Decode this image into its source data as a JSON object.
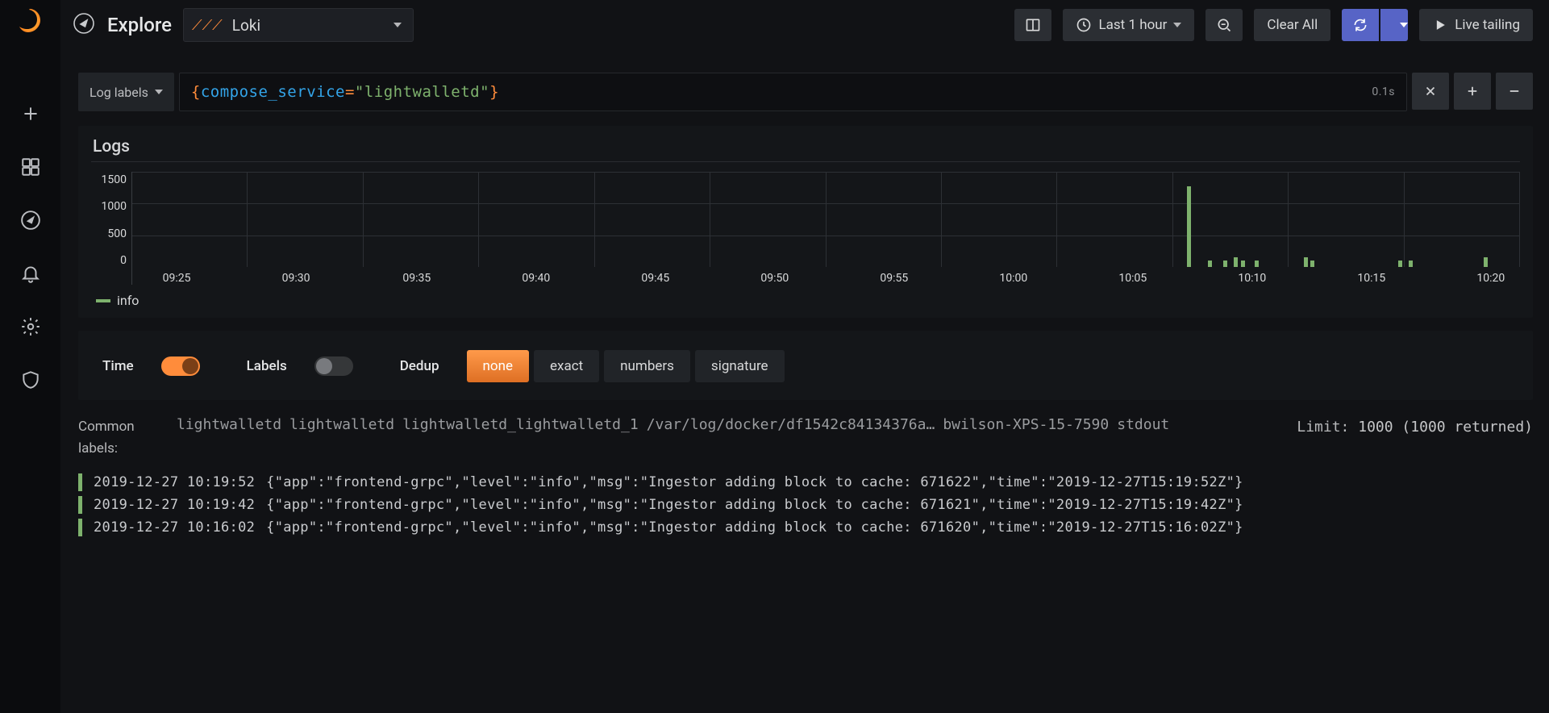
{
  "header": {
    "title": "Explore",
    "datasource": "Loki",
    "time_range": "Last 1 hour",
    "clear_all": "Clear All",
    "live_tailing": "Live tailing"
  },
  "query": {
    "label_button": "Log labels",
    "tokens": {
      "key": "compose_service",
      "value": "\"lightwalletd\""
    },
    "open": "{",
    "close": "}",
    "eq": "=",
    "latency": "0.1s"
  },
  "panel": {
    "title": "Logs"
  },
  "chart_data": {
    "type": "bar",
    "title": "Logs",
    "xlabel": "",
    "ylabel": "",
    "ylim": [
      0,
      1500
    ],
    "y_ticks": [
      "1500",
      "1000",
      "500",
      "0"
    ],
    "x_ticks": [
      "09:25",
      "09:30",
      "09:35",
      "09:40",
      "09:45",
      "09:50",
      "09:55",
      "10:00",
      "10:05",
      "10:10",
      "10:15",
      "10:20"
    ],
    "x_tick_positions_pct": [
      3.2,
      11.8,
      20.5,
      29.1,
      37.7,
      46.3,
      54.9,
      63.5,
      72.1,
      80.7,
      89.3,
      97.9
    ],
    "series": [
      {
        "name": "info",
        "bars": [
          {
            "x_pct": 76.0,
            "value": 1050,
            "cls": "tall"
          },
          {
            "x_pct": 77.5,
            "value": 80,
            "cls": "s"
          },
          {
            "x_pct": 78.6,
            "value": 80,
            "cls": "s"
          },
          {
            "x_pct": 79.4,
            "value": 120,
            "cls": "m"
          },
          {
            "x_pct": 79.9,
            "value": 80,
            "cls": "s"
          },
          {
            "x_pct": 80.9,
            "value": 80,
            "cls": "s"
          },
          {
            "x_pct": 84.4,
            "value": 120,
            "cls": "m"
          },
          {
            "x_pct": 84.9,
            "value": 80,
            "cls": "s"
          },
          {
            "x_pct": 91.2,
            "value": 80,
            "cls": "s"
          },
          {
            "x_pct": 92.0,
            "value": 80,
            "cls": "s"
          },
          {
            "x_pct": 97.4,
            "value": 120,
            "cls": "m"
          }
        ]
      }
    ],
    "legend": [
      "info"
    ]
  },
  "controls": {
    "time_label": "Time",
    "time_on": true,
    "labels_label": "Labels",
    "labels_on": false,
    "dedup_label": "Dedup",
    "dedup_options": [
      "none",
      "exact",
      "numbers",
      "signature"
    ],
    "dedup_active": "none"
  },
  "meta": {
    "common_labels_key": "Common labels:",
    "common_labels": [
      "lightwalletd",
      "lightwalletd",
      "lightwalletd_lightwalletd_1",
      "/var/log/docker/df1542c84134376a…",
      "bwilson-XPS-15-7590",
      "stdout"
    ],
    "limit_key": "Limit:",
    "limit_value": "1000 (1000 returned)"
  },
  "log_rows": [
    {
      "ts": "2019-12-27 10:19:52",
      "msg": "{\"app\":\"frontend-grpc\",\"level\":\"info\",\"msg\":\"Ingestor adding block to cache: 671622\",\"time\":\"2019-12-27T15:19:52Z\"}"
    },
    {
      "ts": "2019-12-27 10:19:42",
      "msg": "{\"app\":\"frontend-grpc\",\"level\":\"info\",\"msg\":\"Ingestor adding block to cache: 671621\",\"time\":\"2019-12-27T15:19:42Z\"}"
    },
    {
      "ts": "2019-12-27 10:16:02",
      "msg": "{\"app\":\"frontend-grpc\",\"level\":\"info\",\"msg\":\"Ingestor adding block to cache: 671620\",\"time\":\"2019-12-27T15:16:02Z\"}"
    }
  ]
}
